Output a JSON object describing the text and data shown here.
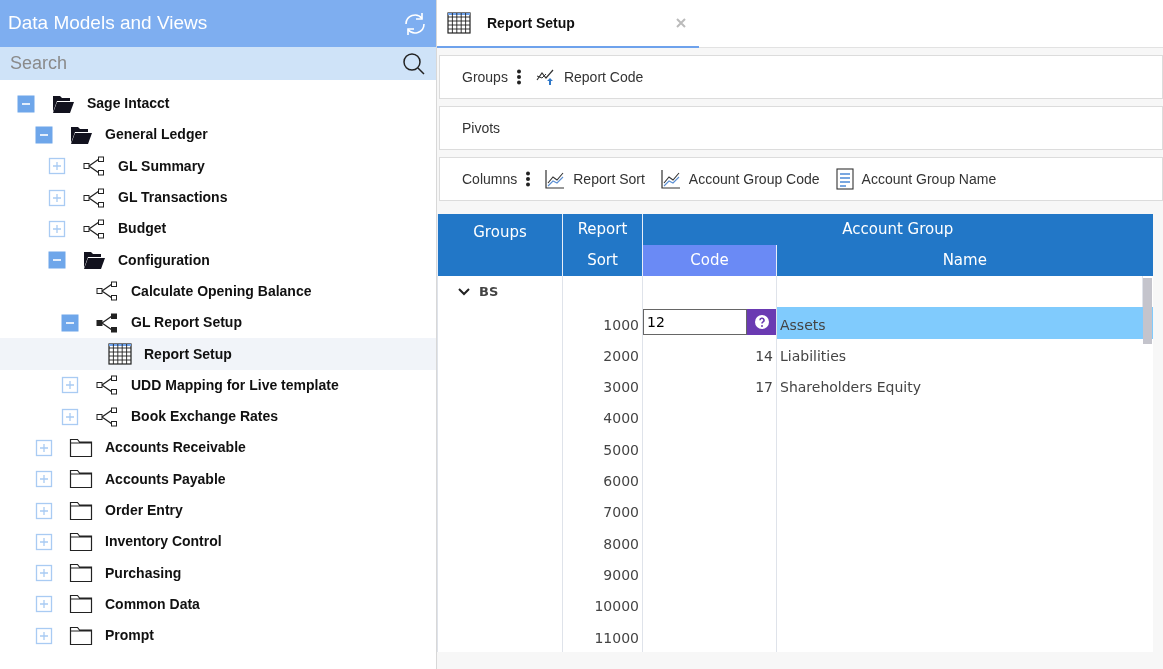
{
  "sidebar": {
    "title": "Data Models and Views",
    "search": {
      "placeholder": "Search"
    },
    "tree": [
      {
        "label": "Sage Intacct",
        "kind": "folder",
        "expandable": true,
        "expanded": true,
        "selected": false,
        "children": [
          {
            "label": "General Ledger",
            "kind": "folder",
            "expandable": true,
            "expanded": true,
            "selected": false,
            "children": [
              {
                "label": "GL Summary",
                "kind": "model",
                "expandable": true,
                "expanded": false,
                "selected": false
              },
              {
                "label": "GL Transactions",
                "kind": "model",
                "expandable": true,
                "expanded": false,
                "selected": false
              },
              {
                "label": "Budget",
                "kind": "model",
                "expandable": true,
                "expanded": false,
                "selected": false
              },
              {
                "label": "Configuration",
                "kind": "folder",
                "expandable": true,
                "expanded": true,
                "selected": false,
                "children": [
                  {
                    "label": "Calculate Opening Balance",
                    "kind": "model",
                    "expandable": false,
                    "selected": false
                  },
                  {
                    "label": "GL Report Setup",
                    "kind": "model",
                    "expandable": true,
                    "expanded": true,
                    "selected": false,
                    "children": [
                      {
                        "label": "Report Setup",
                        "kind": "report",
                        "expandable": false,
                        "selected": true
                      }
                    ]
                  },
                  {
                    "label": "UDD Mapping for Live template",
                    "kind": "model",
                    "expandable": true,
                    "expanded": false,
                    "selected": false
                  },
                  {
                    "label": "Book Exchange Rates",
                    "kind": "model",
                    "expandable": true,
                    "expanded": false,
                    "selected": false
                  }
                ]
              }
            ]
          },
          {
            "label": "Accounts Receivable",
            "kind": "folder",
            "expandable": true,
            "expanded": false,
            "selected": false
          },
          {
            "label": "Accounts Payable",
            "kind": "folder",
            "expandable": true,
            "expanded": false,
            "selected": false
          },
          {
            "label": "Order Entry",
            "kind": "folder",
            "expandable": true,
            "expanded": false,
            "selected": false
          },
          {
            "label": "Inventory Control",
            "kind": "folder",
            "expandable": true,
            "expanded": false,
            "selected": false
          },
          {
            "label": "Purchasing",
            "kind": "folder",
            "expandable": true,
            "expanded": false,
            "selected": false
          },
          {
            "label": "Common Data",
            "kind": "folder",
            "expandable": true,
            "expanded": false,
            "selected": false
          },
          {
            "label": "Prompt",
            "kind": "folder",
            "expandable": true,
            "expanded": false,
            "selected": false
          }
        ]
      }
    ]
  },
  "tabs": [
    {
      "label": "Report Setup",
      "selected": true
    }
  ],
  "shelves": [
    {
      "label": "Groups",
      "menu": true,
      "fields": [
        {
          "label": "Report Code",
          "kind": "group"
        }
      ]
    },
    {
      "label": "Pivots",
      "menu": false
    },
    {
      "label": "Columns",
      "menu": true,
      "fields": [
        {
          "label": "Report Sort",
          "kind": "measure"
        },
        {
          "label": "Account Group Code",
          "kind": "measure"
        },
        {
          "label": "Account Group Name",
          "kind": "text"
        }
      ]
    }
  ],
  "grid": {
    "headers": {
      "groups": "Groups",
      "sort_top": "Report",
      "sort_bottom": "Sort",
      "group": "Account Group",
      "code": "Code",
      "name": "Name"
    },
    "group_row": {
      "label": "BS",
      "expanded": true
    },
    "rows": [
      {
        "sort": "1000",
        "code": "12",
        "name": "Assets",
        "selected": true
      },
      {
        "sort": "2000",
        "code": "14",
        "name": "Liabilities",
        "selected": false
      },
      {
        "sort": "3000",
        "code": "17",
        "name": "Shareholders Equity",
        "selected": false
      },
      {
        "sort": "4000",
        "selected": false
      },
      {
        "sort": "5000",
        "selected": false
      },
      {
        "sort": "6000",
        "selected": false
      },
      {
        "sort": "7000",
        "selected": false
      },
      {
        "sort": "8000",
        "selected": false
      },
      {
        "sort": "9000",
        "selected": false
      },
      {
        "sort": "10000",
        "selected": false
      },
      {
        "sort": "11000",
        "selected": false
      }
    ]
  }
}
